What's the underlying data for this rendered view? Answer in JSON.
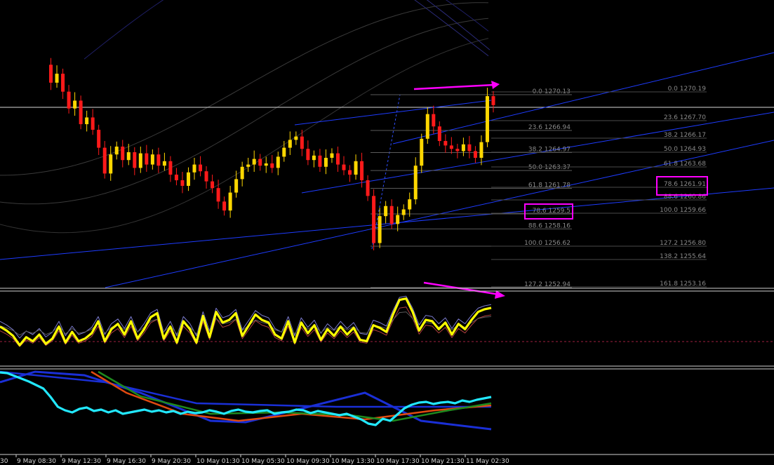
{
  "chart_data": [
    {
      "type": "candlestick",
      "panel": "price",
      "candle_up_color": "#ffd700",
      "candle_down_color": "#ff1a1a",
      "annotation_color": "#ff00ff",
      "price_series": [
        1272.8,
        1271.2,
        1272.0,
        1270.4,
        1268.9,
        1269.6,
        1267.5,
        1268.1,
        1267.0,
        1265.4,
        1263.1,
        1264.8,
        1265.5,
        1264.3,
        1265.0,
        1263.6,
        1264.9,
        1263.9,
        1264.8,
        1263.8,
        1264.2,
        1263.0,
        1262.5,
        1262.0,
        1263.2,
        1263.9,
        1263.3,
        1262.4,
        1261.8,
        1260.6,
        1259.8,
        1261.4,
        1262.6,
        1263.7,
        1263.9,
        1264.4,
        1263.8,
        1264.0,
        1263.6,
        1264.6,
        1265.4,
        1266.1,
        1266.4,
        1265.3,
        1264.3,
        1264.7,
        1263.7,
        1264.5,
        1264.9,
        1263.9,
        1263.4,
        1263.0,
        1264.2,
        1262.5,
        1261.1,
        1256.9,
        1259.3,
        1260.2,
        1258.6,
        1259.4,
        1259.9,
        1260.8,
        1263.8,
        1266.2,
        1268.4,
        1267.3,
        1266.0,
        1265.6,
        1265.3,
        1265.1,
        1265.7,
        1265.1,
        1264.5,
        1265.9,
        1270.0,
        1269.2
      ],
      "fibonacci_levels_a": [
        {
          "label": "0.0 1270.13",
          "value": 1270.13
        },
        {
          "label": "23.6 1266.94",
          "value": 1266.94
        },
        {
          "label": "38.2 1264.97",
          "value": 1264.97
        },
        {
          "label": "50.0 1263.37",
          "value": 1263.37
        },
        {
          "label": "61.8 1261.78",
          "value": 1261.78
        },
        {
          "label": "78.6 1259.5",
          "value": 1259.5
        },
        {
          "label": "88.6 1258.16",
          "value": 1258.16
        },
        {
          "label": "100.0 1256.62",
          "value": 1256.62
        },
        {
          "label": "127.2 1252.94",
          "value": 1252.94
        }
      ],
      "fibonacci_levels_b": [
        {
          "label": "0.0 1270.19",
          "value": 1270.19
        },
        {
          "label": "23.6 1267.70",
          "value": 1267.7
        },
        {
          "label": "38.2 1266.17",
          "value": 1266.17
        },
        {
          "label": "50.0 1264.93",
          "value": 1264.93
        },
        {
          "label": "61.8 1263.68",
          "value": 1263.68
        },
        {
          "label": "78.6 1261.91",
          "value": 1261.91
        },
        {
          "label": "88.6 1260.86",
          "value": 1260.86
        },
        {
          "label": "100.0 1259.66",
          "value": 1259.66
        },
        {
          "label": "127.2 1256.80",
          "value": 1256.8
        },
        {
          "label": "138.2 1255.64",
          "value": 1255.64
        },
        {
          "label": "161.8 1253.16",
          "value": 1253.16
        }
      ],
      "highlighted_levels": [
        "78.6 1259.5",
        "78.6 1261.91"
      ]
    },
    {
      "type": "line",
      "panel": "oscillator",
      "line_color": "#ffff00",
      "values": [
        52,
        46,
        38,
        24,
        36,
        30,
        40,
        26,
        34,
        52,
        28,
        44,
        30,
        34,
        42,
        60,
        30,
        48,
        56,
        40,
        60,
        34,
        48,
        66,
        72,
        34,
        52,
        28,
        60,
        48,
        28,
        68,
        36,
        74,
        58,
        62,
        72,
        38,
        54,
        70,
        62,
        58,
        40,
        34,
        60,
        28,
        58,
        42,
        54,
        32,
        48,
        38,
        52,
        40,
        50,
        32,
        30,
        54,
        50,
        44,
        70,
        92,
        94,
        74,
        46,
        62,
        60,
        48,
        58,
        40,
        56,
        48,
        62,
        74,
        78,
        80
      ]
    },
    {
      "type": "line",
      "panel": "moving-averages",
      "line_color": "#22e8ff",
      "values": [
        97,
        96,
        92,
        88,
        84,
        79,
        74,
        62,
        48,
        43,
        40,
        45,
        47,
        42,
        44,
        40,
        43,
        38,
        40,
        42,
        44,
        41,
        43,
        40,
        42,
        38,
        41,
        39,
        40,
        43,
        41,
        38,
        42,
        44,
        41,
        40,
        42,
        43,
        38,
        40,
        41,
        44,
        43,
        39,
        42,
        40,
        38,
        36,
        38,
        34,
        30,
        24,
        22,
        31,
        28,
        37,
        46,
        51,
        54,
        55,
        52,
        54,
        55,
        53,
        57,
        55,
        58,
        60,
        62
      ]
    }
  ],
  "x_axis": {
    "ticks": [
      "9 May 08:30",
      "9 May 12:30",
      "9 May 16:30",
      "9 May 20:30",
      "10 May 01:30",
      "10 May 05:30",
      "10 May 09:30",
      "10 May 13:30",
      "10 May 17:30",
      "10 May 21:30",
      "11 May 02:30"
    ],
    "edge_fragment": "30"
  }
}
